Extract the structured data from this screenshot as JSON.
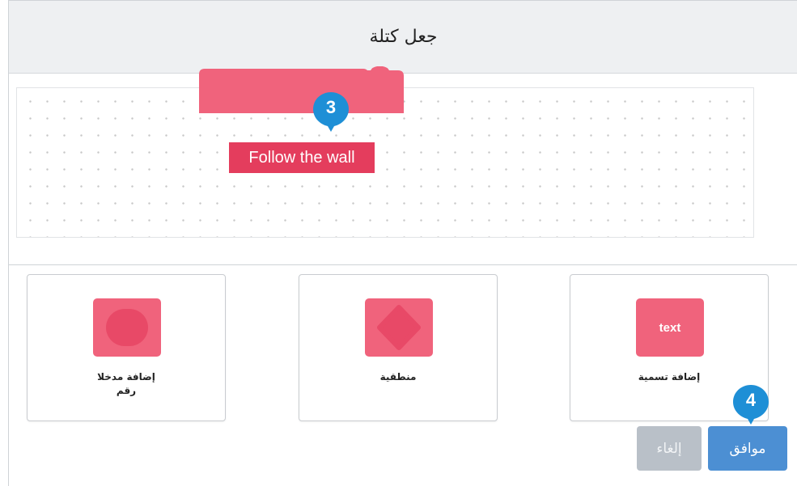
{
  "dialog": {
    "title": "جعل كتلة"
  },
  "block": {
    "label": "Follow the wall",
    "color": "#f0637c",
    "label_bg": "#e43d5d"
  },
  "options": [
    {
      "label_line1": "إضافة مدخلا",
      "label_line2": "رقم",
      "icon": "oval-input-icon"
    },
    {
      "label_line1": "منطقية",
      "icon": "hexagon-boolean-icon"
    },
    {
      "label_line1": "إضافة تسمية",
      "icon": "text-label-icon",
      "chip_text": "text"
    }
  ],
  "buttons": {
    "ok": "موافق",
    "cancel": "إلغاء"
  },
  "markers": {
    "step3": "3",
    "step4": "4"
  },
  "colors": {
    "accent_pink": "#f0637c",
    "primary_blue": "#4c8fd3",
    "disabled_gray": "#b9c0c8",
    "marker_blue": "#1e8fd6"
  }
}
